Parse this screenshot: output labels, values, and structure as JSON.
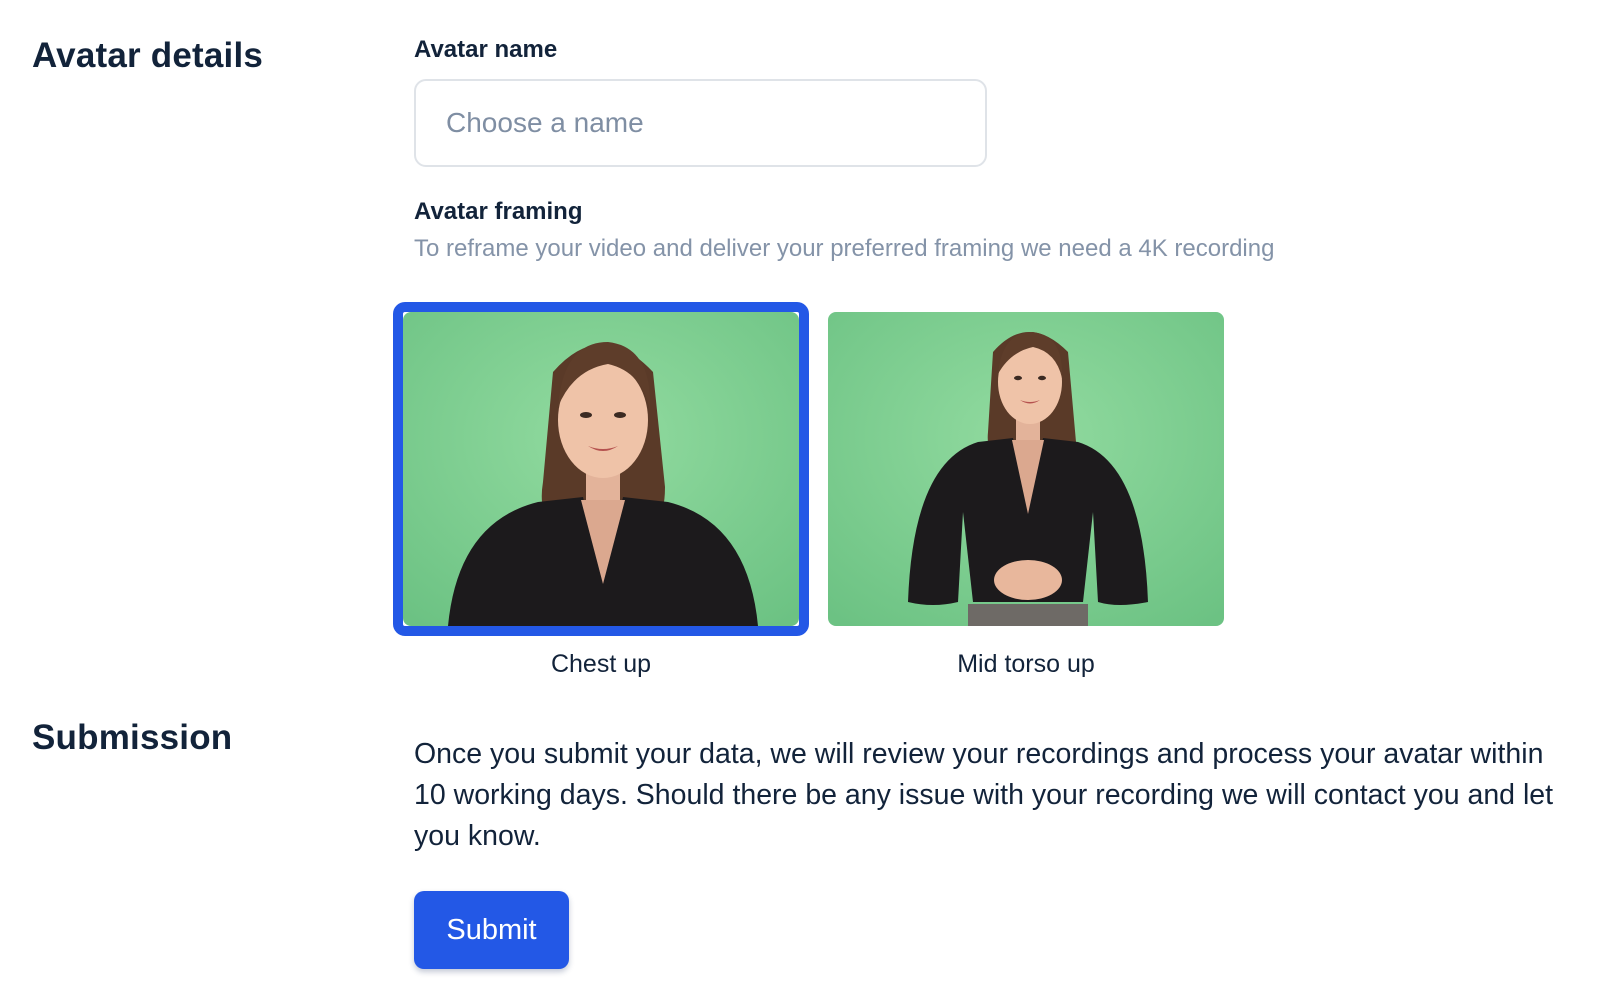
{
  "details": {
    "title": "Avatar details",
    "name_label": "Avatar name",
    "name_placeholder": "Choose a name",
    "framing_label": "Avatar framing",
    "framing_hint": "To reframe your video and deliver your preferred framing we need a 4K recording",
    "options": [
      {
        "caption": "Chest up",
        "selected": true
      },
      {
        "caption": "Mid torso up",
        "selected": false
      }
    ]
  },
  "submission": {
    "title": "Submission",
    "text": "Once you submit your data, we will review your recordings and process your avatar within 10 working days. Should there be any issue with your recording we will contact you and let you know.",
    "submit_label": "Submit"
  },
  "colors": {
    "accent": "#2358e6",
    "text": "#12233a",
    "muted": "#8493a8",
    "green_screen": "#7fd193"
  }
}
